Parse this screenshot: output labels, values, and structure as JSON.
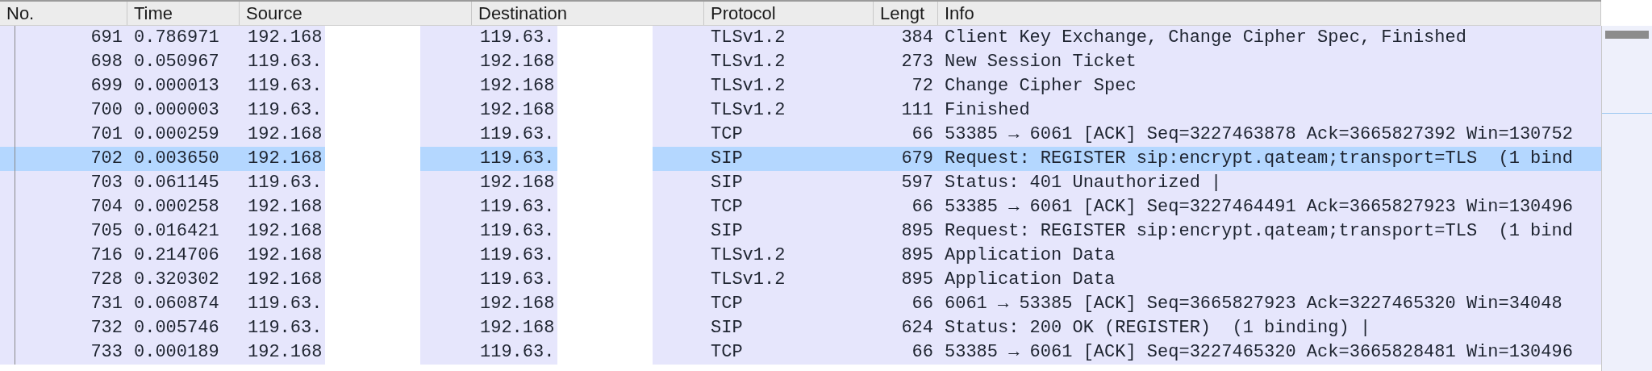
{
  "table": {
    "columns": [
      {
        "label": "No."
      },
      {
        "label": "Time"
      },
      {
        "label": "Source"
      },
      {
        "label": "Destination"
      },
      {
        "label": "Protocol"
      },
      {
        "label": "Lengt"
      },
      {
        "label": "Info"
      }
    ],
    "rows": [
      {
        "no": "691",
        "time": "0.786971",
        "source": "192.168",
        "destination": "119.63.",
        "protocol": "TLSv1.2",
        "length": "384",
        "info": "Client Key Exchange, Change Cipher Spec, Finished",
        "selected": false
      },
      {
        "no": "698",
        "time": "0.050967",
        "source": "119.63.",
        "destination": "192.168",
        "protocol": "TLSv1.2",
        "length": "273",
        "info": "New Session Ticket",
        "selected": false
      },
      {
        "no": "699",
        "time": "0.000013",
        "source": "119.63.",
        "destination": "192.168",
        "protocol": "TLSv1.2",
        "length": "72",
        "info": "Change Cipher Spec",
        "selected": false
      },
      {
        "no": "700",
        "time": "0.000003",
        "source": "119.63.",
        "destination": "192.168",
        "protocol": "TLSv1.2",
        "length": "111",
        "info": "Finished",
        "selected": false
      },
      {
        "no": "701",
        "time": "0.000259",
        "source": "192.168",
        "destination": "119.63.",
        "protocol": "TCP",
        "length": "66",
        "info": "53385 → 6061 [ACK] Seq=3227463878 Ack=3665827392 Win=130752",
        "selected": false
      },
      {
        "no": "702",
        "time": "0.003650",
        "source": "192.168",
        "destination": "119.63.",
        "protocol": "SIP",
        "length": "679",
        "info": "Request: REGISTER sip:encrypt.qateam;transport=TLS  (1 bind",
        "selected": true
      },
      {
        "no": "703",
        "time": "0.061145",
        "source": "119.63.",
        "destination": "192.168",
        "protocol": "SIP",
        "length": "597",
        "info": "Status: 401 Unauthorized |",
        "selected": false
      },
      {
        "no": "704",
        "time": "0.000258",
        "source": "192.168",
        "destination": "119.63.",
        "protocol": "TCP",
        "length": "66",
        "info": "53385 → 6061 [ACK] Seq=3227464491 Ack=3665827923 Win=130496",
        "selected": false
      },
      {
        "no": "705",
        "time": "0.016421",
        "source": "192.168",
        "destination": "119.63.",
        "protocol": "SIP",
        "length": "895",
        "info": "Request: REGISTER sip:encrypt.qateam;transport=TLS  (1 bind",
        "selected": false
      },
      {
        "no": "716",
        "time": "0.214706",
        "source": "192.168",
        "destination": "119.63.",
        "protocol": "TLSv1.2",
        "length": "895",
        "info": "Application Data",
        "selected": false
      },
      {
        "no": "728",
        "time": "0.320302",
        "source": "192.168",
        "destination": "119.63.",
        "protocol": "TLSv1.2",
        "length": "895",
        "info": "Application Data",
        "selected": false
      },
      {
        "no": "731",
        "time": "0.060874",
        "source": "119.63.",
        "destination": "192.168",
        "protocol": "TCP",
        "length": "66",
        "info": "6061 → 53385 [ACK] Seq=3665827923 Ack=3227465320 Win=34048",
        "selected": false
      },
      {
        "no": "732",
        "time": "0.005746",
        "source": "119.63.",
        "destination": "192.168",
        "protocol": "SIP",
        "length": "624",
        "info": "Status: 200 OK (REGISTER)  (1 binding) |",
        "selected": false
      },
      {
        "no": "733",
        "time": "0.000189",
        "source": "192.168",
        "destination": "119.63.",
        "protocol": "TCP",
        "length": "66",
        "info": "53385 → 6061 [ACK] Seq=3227465320 Ack=3665828481 Win=130496",
        "selected": false
      }
    ]
  }
}
